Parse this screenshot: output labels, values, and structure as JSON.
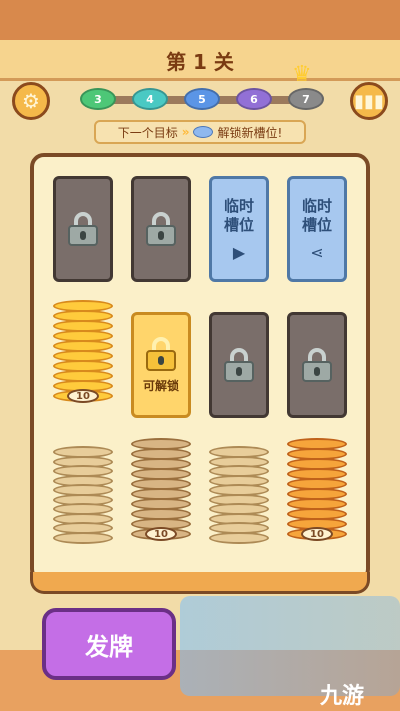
{
  "header": {
    "level_title": "第 1 关"
  },
  "progress": {
    "nodes": [
      {
        "label": "3",
        "color": "#4dc777"
      },
      {
        "label": "4",
        "color": "#4ac9c3"
      },
      {
        "label": "5",
        "color": "#5b95e6"
      },
      {
        "label": "6",
        "color": "#9270d6"
      },
      {
        "label": "7",
        "color": "#8a8a8a"
      }
    ],
    "goal_prefix": "下一个目标",
    "goal_arrows": "»",
    "goal_text": "解锁新槽位!"
  },
  "slots": {
    "temp_label": "临时\n槽位",
    "unlock_label": "可解锁",
    "badge_10": "10"
  },
  "deal_button": {
    "label": "发牌"
  },
  "brand": {
    "text": "九游"
  },
  "icons": {
    "settings": "gear-icon",
    "stats": "bar-chart-icon",
    "crown": "crown-icon",
    "video": "video-icon",
    "share": "share-icon",
    "lock": "lock-icon"
  }
}
